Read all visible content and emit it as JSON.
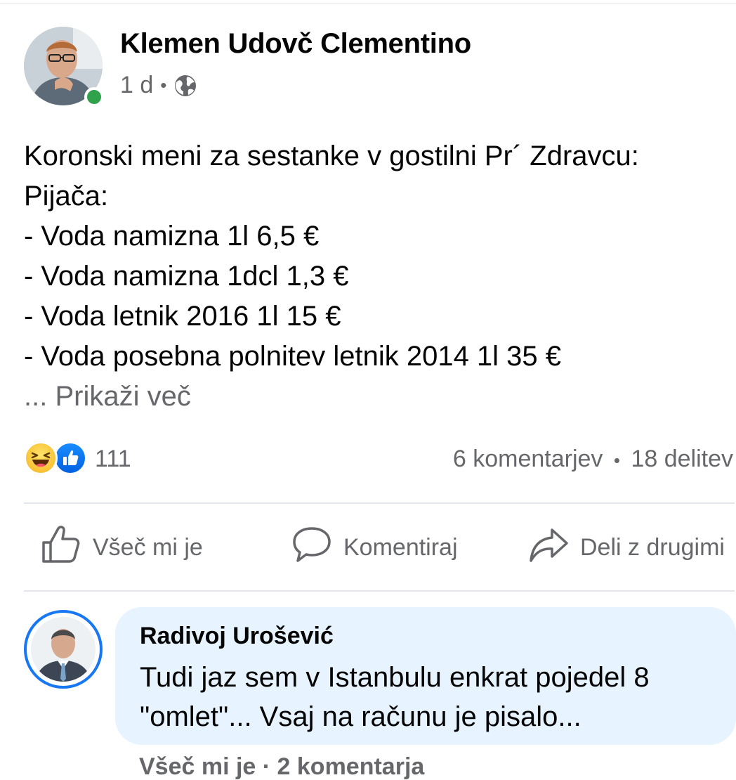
{
  "post": {
    "author": "Klemen Udovč Clementino",
    "time": "1 d",
    "separator": "•",
    "privacy_icon": "globe-icon",
    "text_lines": [
      "Koronski meni za sestanke v gostilni Pr´ Zdravcu:",
      "Pijača:",
      "- Voda namizna 1l 6,5 €",
      "- Voda namizna 1dcl 1,3 €",
      "- Voda letnik 2016 1l 15 €",
      "- Voda posebna polnitev letnik 2014 1l 35 €"
    ],
    "see_more": "... Prikaži več"
  },
  "reactions": {
    "icons": [
      "haha-icon",
      "like-icon"
    ],
    "count": "111",
    "comments": "6 komentarjev",
    "shares": "18 delitev",
    "separator": "•"
  },
  "actions": {
    "like": "Všeč mi je",
    "comment": "Komentiraj",
    "share": "Deli z drugimi"
  },
  "comment": {
    "author": "Radivoj Urošević",
    "text_lines": [
      "Tudi jaz sem v Istanbulu enkrat pojedel 8",
      "\"omlet\"... Vsaj na računu je pisalo..."
    ],
    "footer_partial": "Všeč mi je · 2 komentarja"
  },
  "colors": {
    "online": "#31a24c",
    "like_blue": "#1877f2",
    "comment_bubble": "#e7f3ff",
    "secondary_text": "#65676b"
  }
}
